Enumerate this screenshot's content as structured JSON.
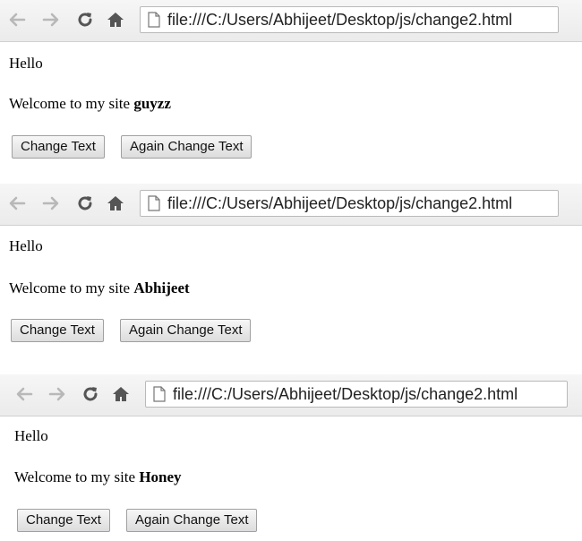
{
  "panels": [
    {
      "url": "file:///C:/Users/Abhijeet/Desktop/js/change2.html",
      "hello": "Hello",
      "welcome_prefix": "Welcome to my site ",
      "welcome_name": "guyzz",
      "button1": "Change Text",
      "button2": "Again Change Text"
    },
    {
      "url": "file:///C:/Users/Abhijeet/Desktop/js/change2.html",
      "hello": "Hello",
      "welcome_prefix": "Welcome to my site ",
      "welcome_name": "Abhijeet",
      "button1": "Change Text",
      "button2": "Again Change Text"
    },
    {
      "url": "file:///C:/Users/Abhijeet/Desktop/js/change2.html",
      "hello": "Hello",
      "welcome_prefix": "Welcome to my site ",
      "welcome_name": "Honey",
      "button1": "Change Text",
      "button2": "Again Change Text"
    }
  ],
  "colors": {
    "toolbar_bg": "#efefef",
    "icon_gray": "#b8b8b8",
    "icon_dark": "#555555",
    "button_border": "#a0a0a0"
  },
  "icons": [
    "back-arrow-icon",
    "forward-arrow-icon",
    "reload-icon",
    "home-icon",
    "page-icon"
  ]
}
